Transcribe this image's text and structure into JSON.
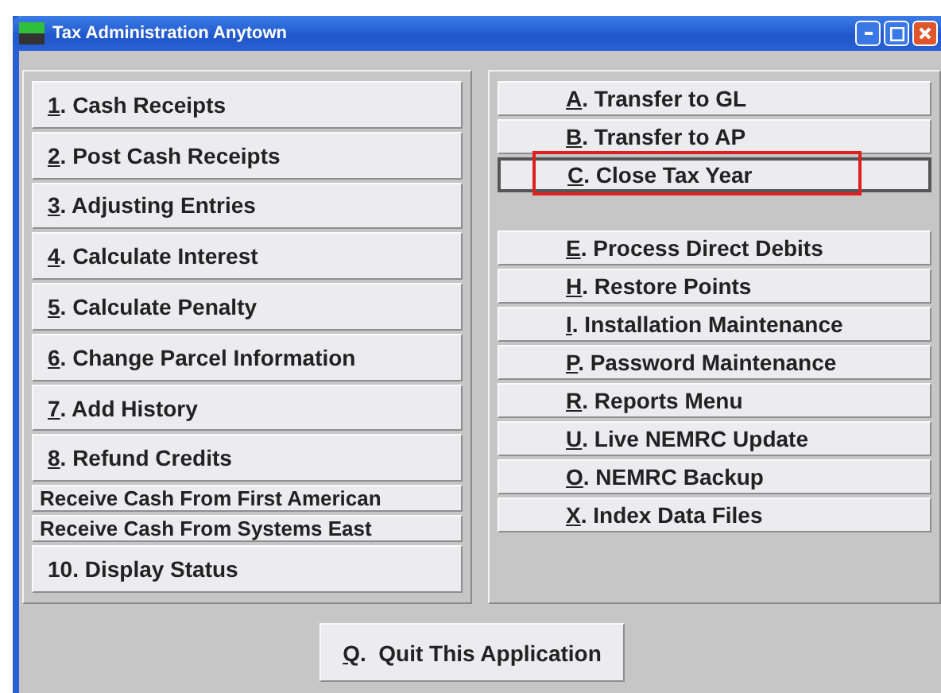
{
  "window": {
    "title": "Tax Administration Anytown"
  },
  "left_menu": [
    {
      "label": "1. Cash Receipts",
      "underline": true,
      "kind": "regular"
    },
    {
      "label": "2. Post Cash Receipts",
      "underline": true,
      "kind": "regular"
    },
    {
      "label": "3. Adjusting Entries",
      "underline": true,
      "kind": "regular"
    },
    {
      "label": "4. Calculate Interest",
      "underline": true,
      "kind": "regular"
    },
    {
      "label": "5. Calculate Penalty",
      "underline": true,
      "kind": "regular"
    },
    {
      "label": "6. Change Parcel Information",
      "underline": true,
      "kind": "regular"
    },
    {
      "label": "7. Add History",
      "underline": true,
      "kind": "regular"
    },
    {
      "label": "8. Refund Credits",
      "underline": true,
      "kind": "regular"
    },
    {
      "label": "Receive Cash From First American",
      "underline": false,
      "kind": "compact"
    },
    {
      "label": "Receive Cash From Systems East",
      "underline": false,
      "kind": "compact"
    },
    {
      "label": "10. Display Status",
      "underline": false,
      "kind": "regular"
    }
  ],
  "right_menu": [
    {
      "label": "A. Transfer to GL",
      "underline": true,
      "focused": false,
      "highlighted": false,
      "gap_after": false
    },
    {
      "label": "B. Transfer to AP",
      "underline": true,
      "focused": false,
      "highlighted": false,
      "gap_after": false
    },
    {
      "label": "C. Close Tax Year",
      "underline": true,
      "focused": true,
      "highlighted": true,
      "gap_after": true
    },
    {
      "label": "E. Process Direct Debits",
      "underline": true,
      "focused": false,
      "highlighted": false,
      "gap_after": false
    },
    {
      "label": "H. Restore Points",
      "underline": true,
      "focused": false,
      "highlighted": false,
      "gap_after": false
    },
    {
      "label": "I. Installation Maintenance",
      "underline": true,
      "focused": false,
      "highlighted": false,
      "gap_after": false
    },
    {
      "label": "P. Password Maintenance",
      "underline": true,
      "focused": false,
      "highlighted": false,
      "gap_after": false
    },
    {
      "label": "R. Reports Menu",
      "underline": true,
      "focused": false,
      "highlighted": false,
      "gap_after": false
    },
    {
      "label": "U. Live NEMRC Update",
      "underline": true,
      "focused": false,
      "highlighted": false,
      "gap_after": false
    },
    {
      "label": "O. NEMRC Backup",
      "underline": true,
      "focused": false,
      "highlighted": false,
      "gap_after": false
    },
    {
      "label": "X. Index Data Files",
      "underline": true,
      "focused": false,
      "highlighted": false,
      "gap_after": false
    }
  ],
  "quit_button": {
    "label": "Q.  Quit This Application",
    "underline": true
  }
}
